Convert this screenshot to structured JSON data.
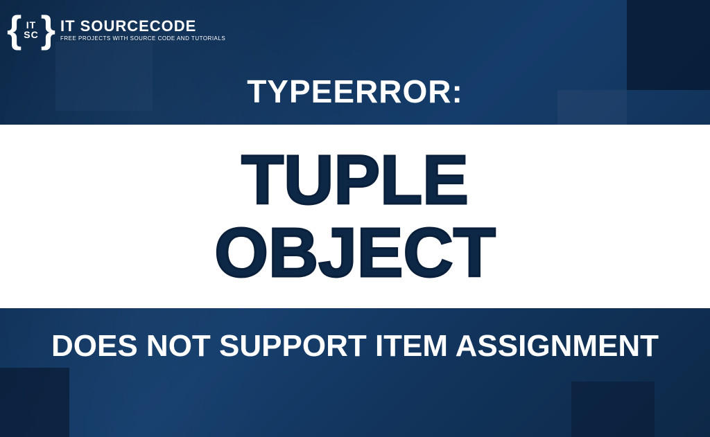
{
  "logo": {
    "initials_line1": "IT",
    "initials_line2": "SC",
    "title": "IT SOURCECODE",
    "subtitle": "FREE PROJECTS WITH SOURCE CODE AND TUTORIALS"
  },
  "content": {
    "header": "TYPEERROR:",
    "main_line1": "TUPLE",
    "main_line2": "OBJECT",
    "footer": "DOES NOT SUPPORT ITEM ASSIGNMENT"
  },
  "colors": {
    "background_dark": "#0d2847",
    "background_mid": "#153d6b",
    "text_white": "#ffffff",
    "text_navy": "#0d2847"
  }
}
